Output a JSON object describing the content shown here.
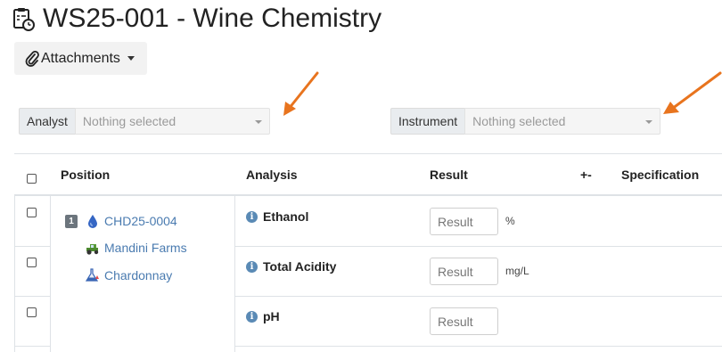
{
  "page": {
    "title": "WS25-001 - Wine Chemistry",
    "title_icon": "clipboard-clock-icon"
  },
  "toolbar": {
    "attachments_label": "Attachments",
    "attachments_icon": "paperclip-icon"
  },
  "filters": {
    "analyst": {
      "label": "Analyst",
      "placeholder": "Nothing selected"
    },
    "instrument": {
      "label": "Instrument",
      "placeholder": "Nothing selected"
    }
  },
  "annotations": {
    "arrow_color": "#e8741e"
  },
  "table": {
    "headers": {
      "position": "Position",
      "analysis": "Analysis",
      "result": "Result",
      "plusminus": "+-",
      "specification": "Specification"
    },
    "position": {
      "number": "1",
      "sample_id": "CHD25-0004",
      "client": "Mandini Farms",
      "sample_type": "Chardonnay"
    },
    "rows": [
      {
        "analysis": "Ethanol",
        "result_placeholder": "Result",
        "unit": "%"
      },
      {
        "analysis": "Total Acidity",
        "result_placeholder": "Result",
        "unit": "mg/L"
      },
      {
        "analysis": "pH",
        "result_placeholder": "Result",
        "unit": ""
      }
    ]
  },
  "colors": {
    "link": "#4a7bb0",
    "info": "#5a8ab5",
    "badge": "#6c757d"
  }
}
